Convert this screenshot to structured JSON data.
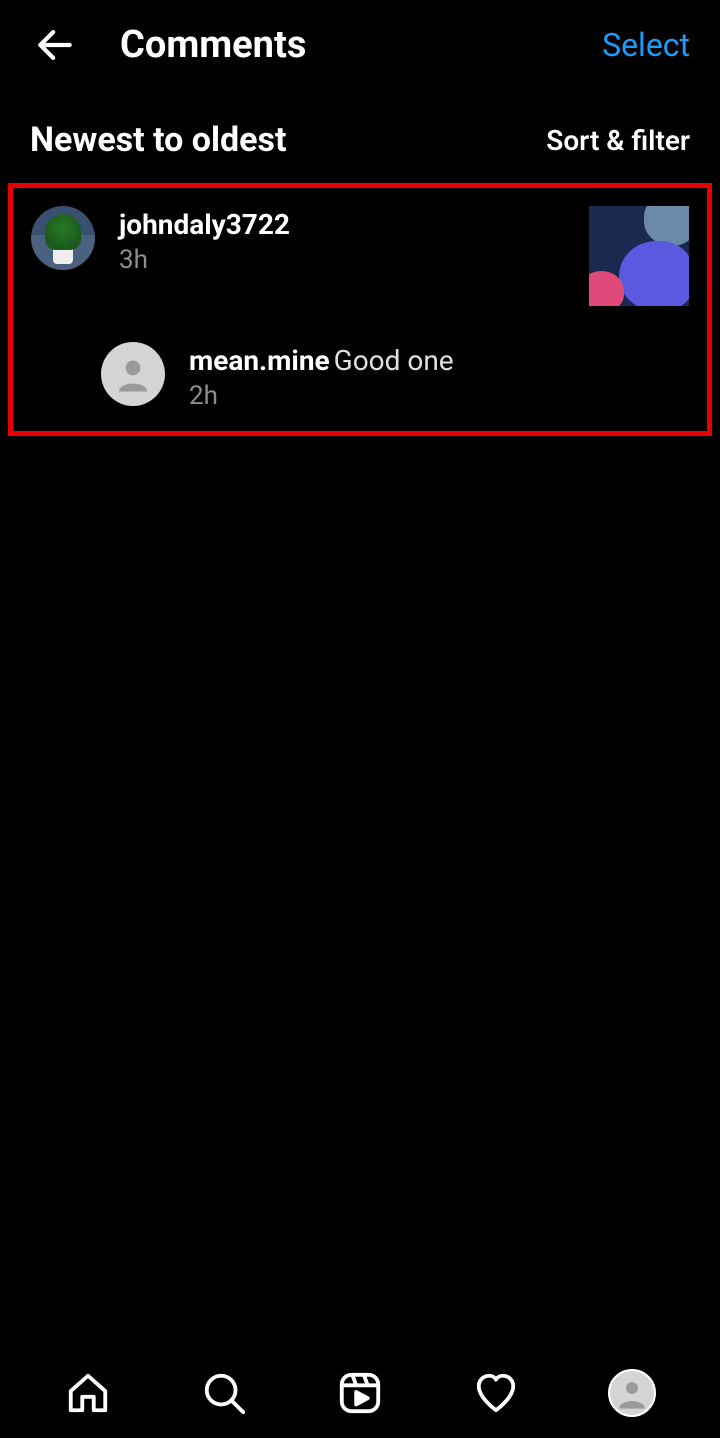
{
  "header": {
    "title": "Comments",
    "select_label": "Select"
  },
  "subheader": {
    "sort_label": "Newest to oldest",
    "filter_label": "Sort & filter"
  },
  "comments": [
    {
      "username": "johndaly3722",
      "text": "",
      "timestamp": "3h",
      "replies": [
        {
          "username": "mean.mine",
          "text": "Good one",
          "timestamp": "2h"
        }
      ]
    }
  ],
  "icons": {
    "back": "back-arrow",
    "home": "home-icon",
    "search": "search-icon",
    "reels": "reels-icon",
    "activity": "heart-icon",
    "profile": "profile-icon"
  }
}
